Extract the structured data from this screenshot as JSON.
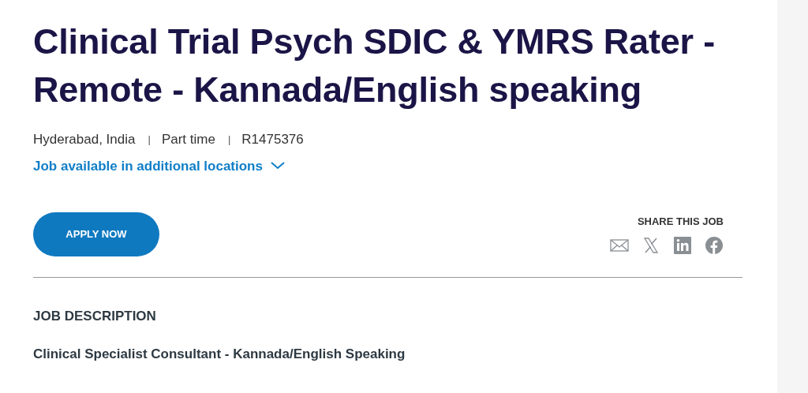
{
  "job": {
    "title": "Clinical Trial Psych SDIC & YMRS Rater - Remote - Kannada/English speaking",
    "meta": [
      "Hyderabad, India",
      "Part time",
      "R1475376"
    ],
    "separator": "|",
    "more_locations": {
      "label": "Job available in additional locations",
      "expanded": false
    },
    "apply_button": "APPLY NOW",
    "share": {
      "label": "SHARE THIS JOB",
      "icons": [
        {
          "kind": "email"
        },
        {
          "kind": "x"
        },
        {
          "kind": "linkedin"
        },
        {
          "kind": "facebook"
        }
      ]
    },
    "description": {
      "heading": "JOB DESCRIPTION",
      "subtitle": "Clinical Specialist Consultant - Kannada/English Speaking"
    }
  }
}
